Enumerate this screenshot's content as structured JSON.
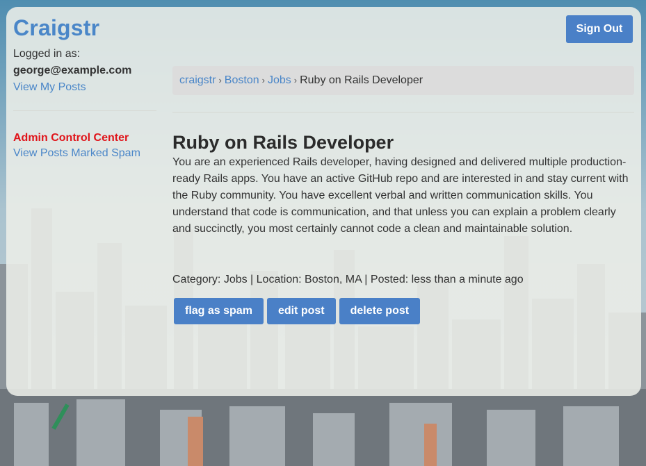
{
  "header": {
    "brand": "Craigstr",
    "sign_out_label": "Sign Out"
  },
  "sidebar": {
    "logged_in_label": "Logged in as:",
    "email": "george@example.com",
    "view_posts_label": "View My Posts",
    "admin_title": "Admin Control Center",
    "admin_spam_link": "View Posts Marked Spam"
  },
  "breadcrumb": {
    "items": [
      "craigstr",
      "Boston",
      "Jobs"
    ],
    "current": "Ruby on Rails Developer",
    "separator": "›"
  },
  "post": {
    "title": "Ruby on Rails Developer",
    "body": "You are an experienced Rails developer, having designed and delivered multiple production-ready Rails apps. You have an active GitHub repo and are interested in and stay current with the Ruby community. You have excellent verbal and written communication skills. You understand that code is communication, and that unless you can explain a problem clearly and succinctly, you most certainly cannot code a clean and maintainable solution.",
    "meta": "Category: Jobs | Location: Boston, MA | Posted: less than a minute ago",
    "actions": {
      "flag_label": "flag as spam",
      "edit_label": "edit post",
      "delete_label": "delete post"
    }
  },
  "colors": {
    "accent": "#4a80c7",
    "link": "#4a86c8",
    "admin_red": "#e0141a",
    "panel": "#eceee8"
  }
}
